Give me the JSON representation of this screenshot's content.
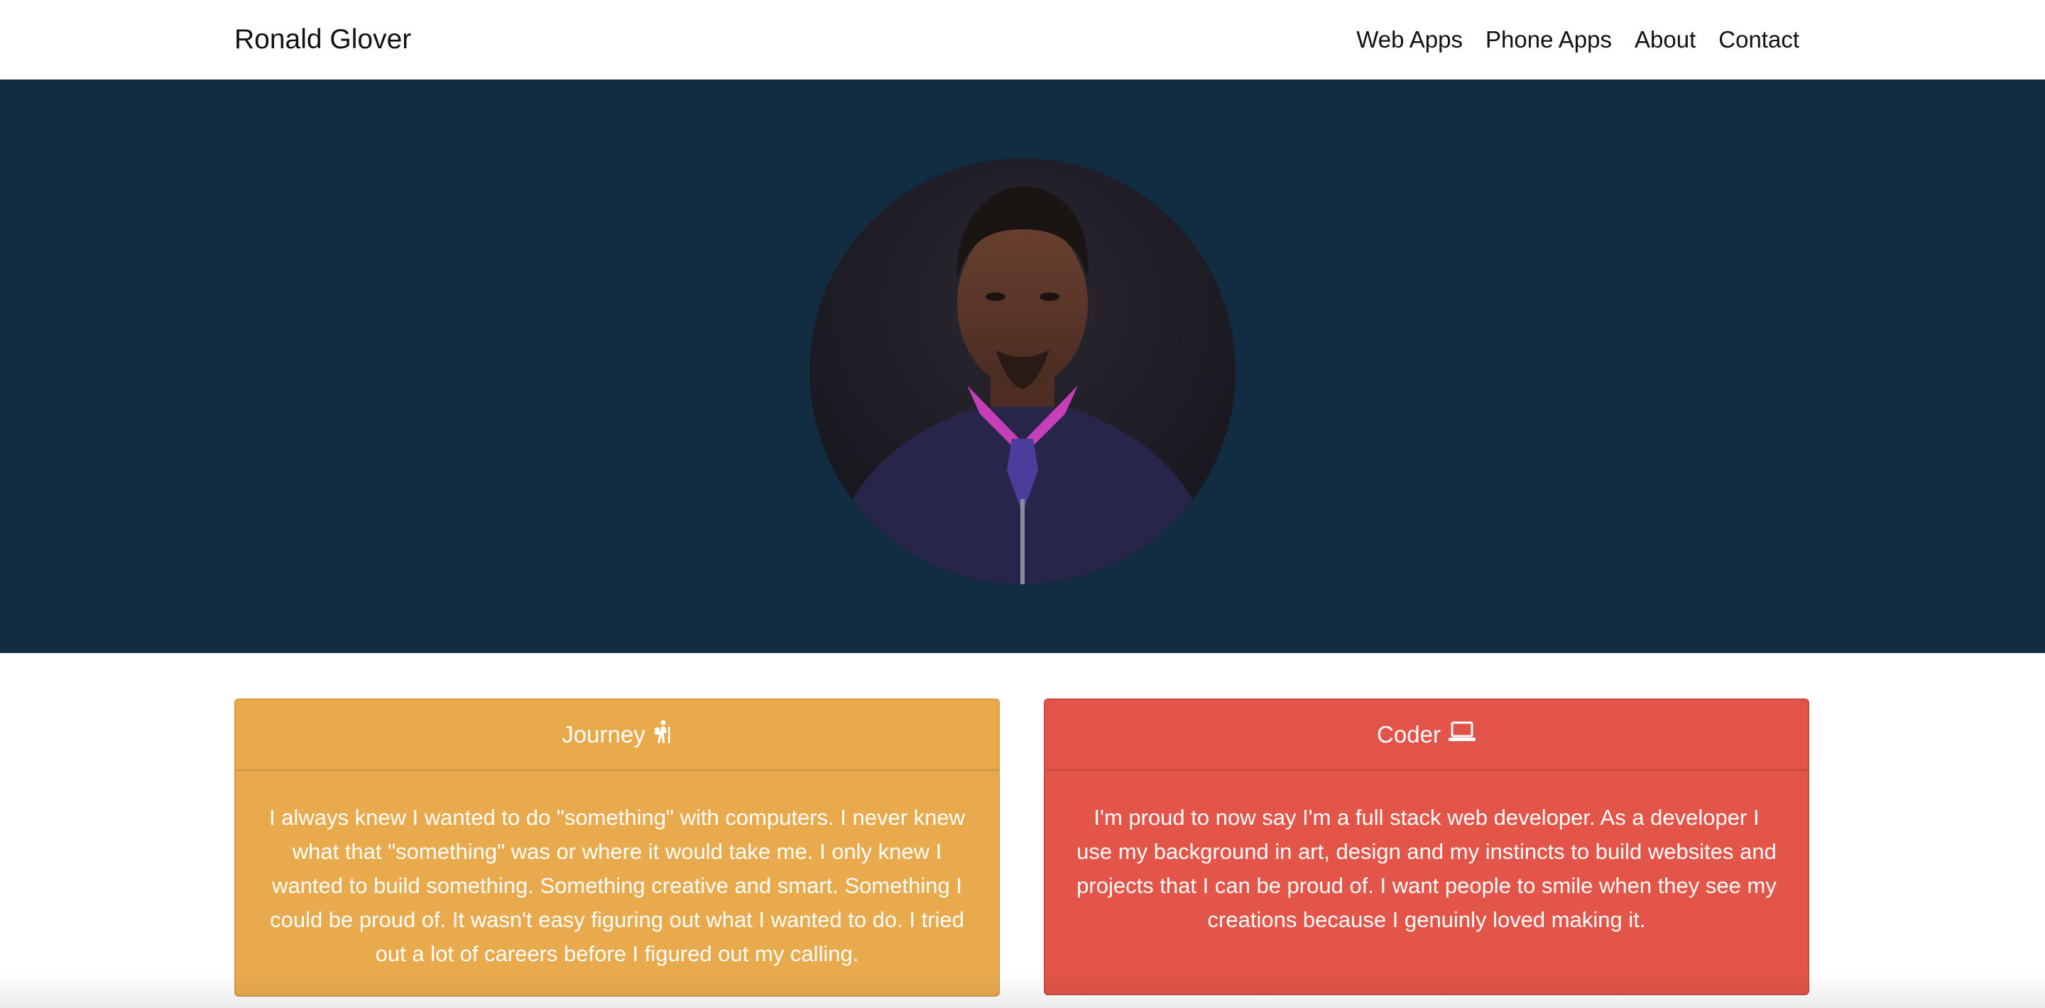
{
  "navbar": {
    "brand": "Ronald Glover",
    "links": [
      "Web Apps",
      "Phone Apps",
      "About",
      "Contact"
    ]
  },
  "hero": {
    "avatar_icon": "profile-photo"
  },
  "cards": [
    {
      "title": "Journey",
      "icon": "hiker-icon",
      "color": "#e9aa4d",
      "body": "I always knew I wanted to do \"something\" with computers. I never knew what that \"something\" was or where it would take me. I only knew I wanted to build something. Something creative and smart. Something I could be proud of. It wasn't easy figuring out what I wanted to do. I tried out a lot of careers before I figured out my calling."
    },
    {
      "title": "Coder",
      "icon": "laptop-icon",
      "color": "#e25548",
      "body": "I'm proud to now say I'm a full stack web developer. As a developer I use my background in art, design and my instincts to build websites and projects that I can be proud of. I want people to smile when they see my creations because I genuinly loved making it."
    }
  ],
  "colors": {
    "hero_bg": "#122d41",
    "text_dark": "#111111"
  }
}
